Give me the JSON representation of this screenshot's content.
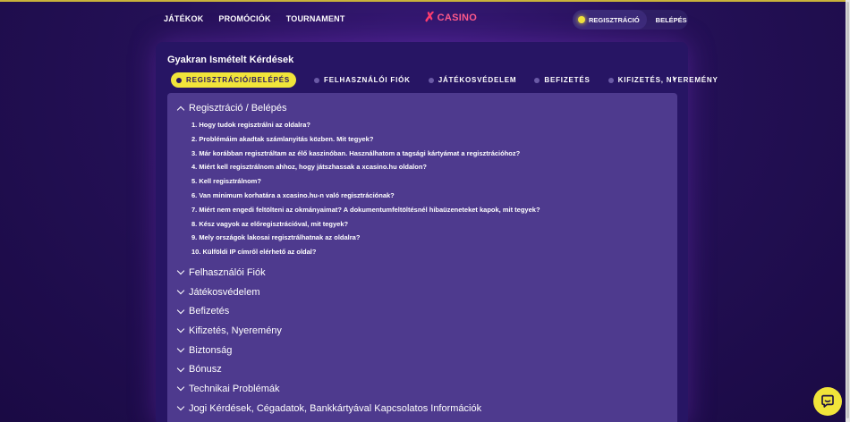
{
  "header": {
    "nav": [
      "JÁTÉKOK",
      "PROMÓCIÓK",
      "TOURNAMENT"
    ],
    "logo_mark": "✗",
    "logo_text": "CASINO",
    "register_label": "REGISZTRÁCIÓ",
    "login_label": "BELÉPÉS"
  },
  "faq": {
    "title": "Gyakran Ismételt Kérdések",
    "tabs": [
      "REGISZTRÁCIÓ/BELÉPÉS",
      "FELHASZNÁLÓI FIÓK",
      "JÁTÉKOSVÉDELEM",
      "BEFIZETÉS",
      "KIFIZETÉS, NYEREMÉNY"
    ],
    "tabs_next": "›",
    "open_section": "Regisztráció / Belépés",
    "questions": [
      "1. Hogy tudok regisztrálni az oldalra?",
      "2. Problémáim akadtak számlanyitás közben. Mit tegyek?",
      "3. Már korábban regisztráltam az élő kaszinóban. Használhatom a tagsági kártyámat a regisztrációhoz?",
      "4. Miért kell regisztrálnom ahhoz, hogy játszhassak a xcasino.hu oldalon?",
      "5. Kell regisztrálnom?",
      "6. Van minimum korhatára a xcasino.hu-n való regisztrációnak?",
      "7. Miért nem engedi feltölteni az okmányaimat? A dokumentumfeltöltésnél hibaüzeneteket kapok, mit tegyek?",
      "8. Kész vagyok az előregisztrációval, mit tegyek?",
      "9. Mely országok lakosai regisztrálhatnak az oldalra?",
      "10. Külföldi IP címről elérhető az oldal?"
    ],
    "sections": [
      "Felhasználói Fiók",
      "Játékosvédelem",
      "Befizetés",
      "Kifizetés, Nyeremény",
      "Biztonság",
      "Bónusz",
      "Technikai Problémák",
      "Jogi Kérdések, Cégadatok, Bankkártyával Kapcsolatos Információk"
    ]
  },
  "colors": {
    "accent": "#f1e43a",
    "background": "#241056",
    "card": "#271564",
    "panel": "#4e3a8e",
    "logo": "#ff3d6e"
  },
  "icons": {
    "chat": "chat-bubble-icon",
    "chevron": "chevron-icon"
  }
}
